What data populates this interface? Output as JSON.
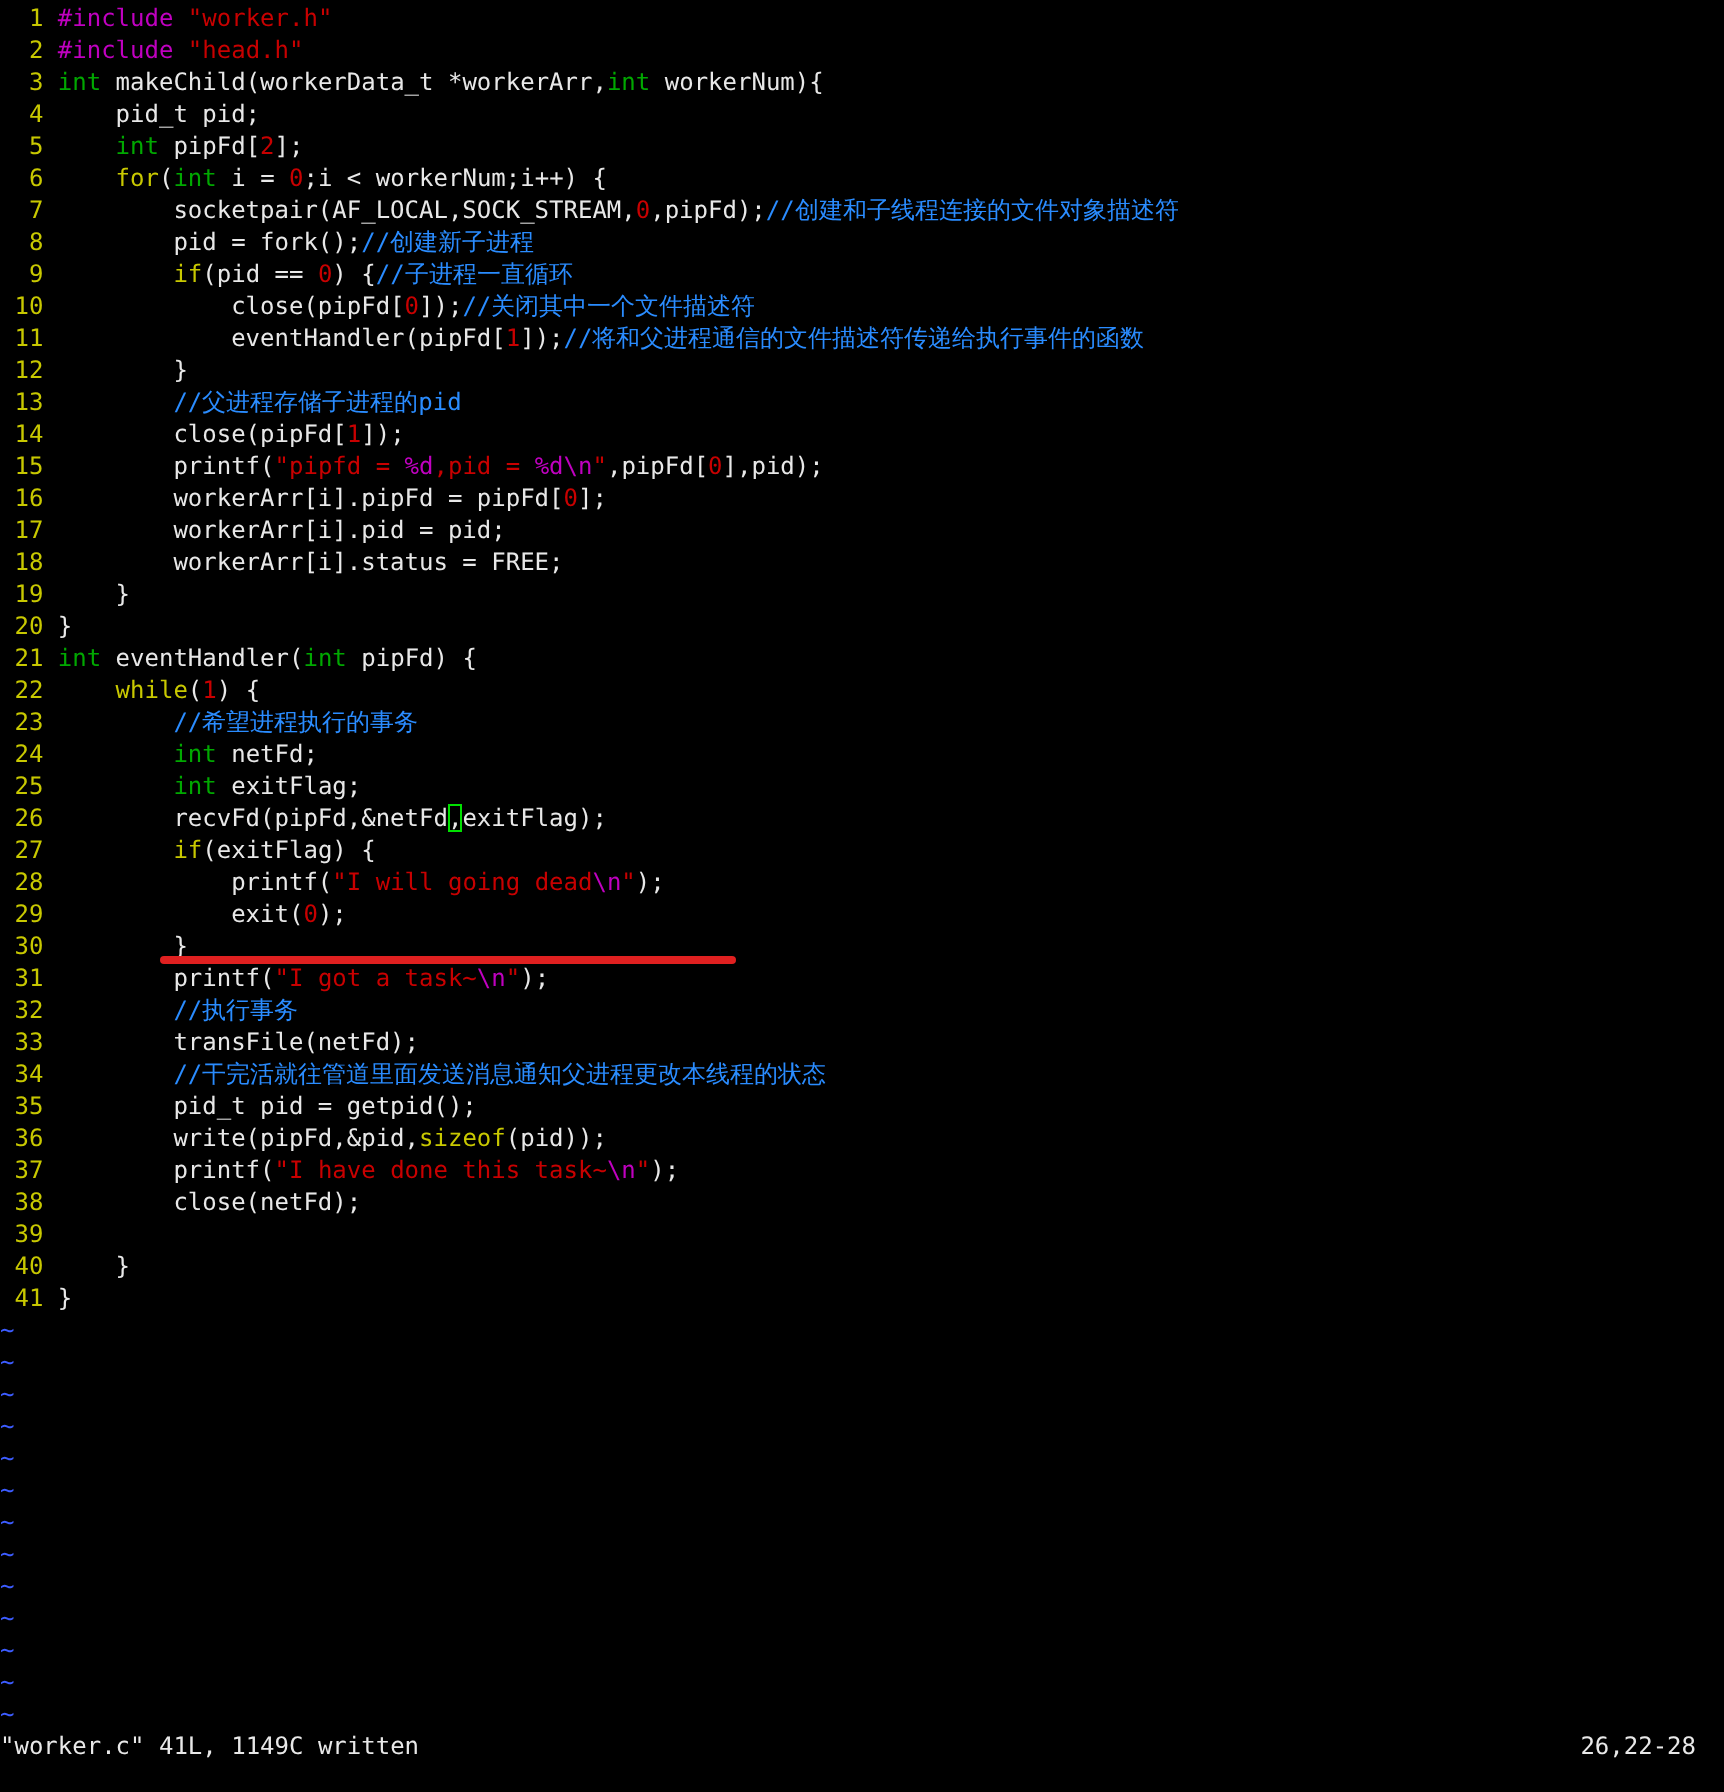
{
  "editor": {
    "lines": [
      {
        "number": "1",
        "tokens": [
          {
            "kind": "preproc",
            "text": "#include "
          },
          {
            "kind": "string",
            "text": "\"worker.h\""
          }
        ]
      },
      {
        "number": "2",
        "tokens": [
          {
            "kind": "preproc",
            "text": "#include "
          },
          {
            "kind": "string",
            "text": "\"head.h\""
          }
        ]
      },
      {
        "number": "3",
        "tokens": [
          {
            "kind": "type",
            "text": "int"
          },
          {
            "kind": "plain",
            "text": " makeChild(workerData_t *workerArr,"
          },
          {
            "kind": "type",
            "text": "int"
          },
          {
            "kind": "plain",
            "text": " workerNum){"
          }
        ]
      },
      {
        "number": "4",
        "tokens": [
          {
            "kind": "plain",
            "text": "    pid_t pid;"
          }
        ]
      },
      {
        "number": "5",
        "tokens": [
          {
            "kind": "type",
            "text": "    int"
          },
          {
            "kind": "plain",
            "text": " pipFd["
          },
          {
            "kind": "number",
            "text": "2"
          },
          {
            "kind": "plain",
            "text": "];"
          }
        ]
      },
      {
        "number": "6",
        "tokens": [
          {
            "kind": "statement",
            "text": "    for"
          },
          {
            "kind": "plain",
            "text": "("
          },
          {
            "kind": "type",
            "text": "int"
          },
          {
            "kind": "plain",
            "text": " i = "
          },
          {
            "kind": "number",
            "text": "0"
          },
          {
            "kind": "plain",
            "text": ";i < workerNum;i++) {"
          }
        ]
      },
      {
        "number": "7",
        "tokens": [
          {
            "kind": "plain",
            "text": "        socketpair(AF_LOCAL,SOCK_STREAM,"
          },
          {
            "kind": "number",
            "text": "0"
          },
          {
            "kind": "plain",
            "text": ",pipFd);"
          },
          {
            "kind": "comment",
            "text": "//创建和子线程连接的文件对象描述符"
          }
        ]
      },
      {
        "number": "8",
        "tokens": [
          {
            "kind": "plain",
            "text": "        pid = fork();"
          },
          {
            "kind": "comment",
            "text": "//创建新子进程"
          }
        ]
      },
      {
        "number": "9",
        "tokens": [
          {
            "kind": "statement",
            "text": "        if"
          },
          {
            "kind": "plain",
            "text": "(pid == "
          },
          {
            "kind": "number",
            "text": "0"
          },
          {
            "kind": "plain",
            "text": ") {"
          },
          {
            "kind": "comment",
            "text": "//子进程一直循环"
          }
        ]
      },
      {
        "number": "10",
        "tokens": [
          {
            "kind": "plain",
            "text": "            close(pipFd["
          },
          {
            "kind": "number",
            "text": "0"
          },
          {
            "kind": "plain",
            "text": "]);"
          },
          {
            "kind": "comment",
            "text": "//关闭其中一个文件描述符"
          }
        ]
      },
      {
        "number": "11",
        "tokens": [
          {
            "kind": "plain",
            "text": "            eventHandler(pipFd["
          },
          {
            "kind": "number",
            "text": "1"
          },
          {
            "kind": "plain",
            "text": "]);"
          },
          {
            "kind": "comment",
            "text": "//将和父进程通信的文件描述符传递给执行事件的函数"
          }
        ]
      },
      {
        "number": "12",
        "tokens": [
          {
            "kind": "plain",
            "text": "        }"
          }
        ]
      },
      {
        "number": "13",
        "tokens": [
          {
            "kind": "comment",
            "text": "        //父进程存储子进程的pid"
          }
        ]
      },
      {
        "number": "14",
        "tokens": [
          {
            "kind": "plain",
            "text": "        close(pipFd["
          },
          {
            "kind": "number",
            "text": "1"
          },
          {
            "kind": "plain",
            "text": "]);"
          }
        ]
      },
      {
        "number": "15",
        "tokens": [
          {
            "kind": "plain",
            "text": "        printf("
          },
          {
            "kind": "string",
            "text": "\"pipfd = "
          },
          {
            "kind": "special",
            "text": "%d"
          },
          {
            "kind": "string",
            "text": ",pid = "
          },
          {
            "kind": "special",
            "text": "%d\\n"
          },
          {
            "kind": "string",
            "text": "\""
          },
          {
            "kind": "plain",
            "text": ",pipFd["
          },
          {
            "kind": "number",
            "text": "0"
          },
          {
            "kind": "plain",
            "text": "],pid);"
          }
        ]
      },
      {
        "number": "16",
        "tokens": [
          {
            "kind": "plain",
            "text": "        workerArr[i].pipFd = pipFd["
          },
          {
            "kind": "number",
            "text": "0"
          },
          {
            "kind": "plain",
            "text": "];"
          }
        ]
      },
      {
        "number": "17",
        "tokens": [
          {
            "kind": "plain",
            "text": "        workerArr[i].pid = pid;"
          }
        ]
      },
      {
        "number": "18",
        "tokens": [
          {
            "kind": "plain",
            "text": "        workerArr[i].status = FREE;"
          }
        ]
      },
      {
        "number": "19",
        "tokens": [
          {
            "kind": "plain",
            "text": "    }"
          }
        ]
      },
      {
        "number": "20",
        "tokens": [
          {
            "kind": "plain",
            "text": "}"
          }
        ]
      },
      {
        "number": "21",
        "tokens": [
          {
            "kind": "type",
            "text": "int"
          },
          {
            "kind": "plain",
            "text": " eventHandler("
          },
          {
            "kind": "type",
            "text": "int"
          },
          {
            "kind": "plain",
            "text": " pipFd) {"
          }
        ]
      },
      {
        "number": "22",
        "tokens": [
          {
            "kind": "statement",
            "text": "    while"
          },
          {
            "kind": "plain",
            "text": "("
          },
          {
            "kind": "number",
            "text": "1"
          },
          {
            "kind": "plain",
            "text": ") {"
          }
        ]
      },
      {
        "number": "23",
        "tokens": [
          {
            "kind": "comment",
            "text": "        //希望进程执行的事务"
          }
        ]
      },
      {
        "number": "24",
        "tokens": [
          {
            "kind": "type",
            "text": "        int"
          },
          {
            "kind": "plain",
            "text": " netFd;"
          }
        ]
      },
      {
        "number": "25",
        "tokens": [
          {
            "kind": "type",
            "text": "        int"
          },
          {
            "kind": "plain",
            "text": " exitFlag;"
          }
        ]
      },
      {
        "number": "26",
        "tokens": [
          {
            "kind": "plain",
            "text": "        recvFd(pipFd,&netFd"
          },
          {
            "kind": "plain",
            "text": ",",
            "cursor": true
          },
          {
            "kind": "plain",
            "text": "exitFlag);"
          }
        ]
      },
      {
        "number": "27",
        "tokens": [
          {
            "kind": "statement",
            "text": "        if"
          },
          {
            "kind": "plain",
            "text": "(exitFlag) {"
          }
        ]
      },
      {
        "number": "28",
        "tokens": [
          {
            "kind": "plain",
            "text": "            printf("
          },
          {
            "kind": "string",
            "text": "\"I will going dead"
          },
          {
            "kind": "special",
            "text": "\\n"
          },
          {
            "kind": "string",
            "text": "\""
          },
          {
            "kind": "plain",
            "text": ");"
          }
        ]
      },
      {
        "number": "29",
        "tokens": [
          {
            "kind": "plain",
            "text": "            exit("
          },
          {
            "kind": "number",
            "text": "0"
          },
          {
            "kind": "plain",
            "text": ");"
          }
        ]
      },
      {
        "number": "30",
        "tokens": [
          {
            "kind": "plain",
            "text": "        }"
          }
        ]
      },
      {
        "number": "31",
        "annotation_mark": true,
        "tokens": [
          {
            "kind": "plain",
            "text": "        printf("
          },
          {
            "kind": "string",
            "text": "\"I got a task~"
          },
          {
            "kind": "special",
            "text": "\\n"
          },
          {
            "kind": "string",
            "text": "\""
          },
          {
            "kind": "plain",
            "text": ");"
          }
        ]
      },
      {
        "number": "32",
        "tokens": [
          {
            "kind": "comment",
            "text": "        //执行事务"
          }
        ]
      },
      {
        "number": "33",
        "tokens": [
          {
            "kind": "plain",
            "text": "        transFile(netFd);"
          }
        ]
      },
      {
        "number": "34",
        "tokens": [
          {
            "kind": "comment",
            "text": "        //干完活就往管道里面发送消息通知父进程更改本线程的状态"
          }
        ]
      },
      {
        "number": "35",
        "tokens": [
          {
            "kind": "plain",
            "text": "        pid_t pid = getpid();"
          }
        ]
      },
      {
        "number": "36",
        "tokens": [
          {
            "kind": "plain",
            "text": "        write(pipFd,&pid,"
          },
          {
            "kind": "statement",
            "text": "sizeof"
          },
          {
            "kind": "plain",
            "text": "(pid));"
          }
        ]
      },
      {
        "number": "37",
        "tokens": [
          {
            "kind": "plain",
            "text": "        printf("
          },
          {
            "kind": "string",
            "text": "\"I have done this task~"
          },
          {
            "kind": "special",
            "text": "\\n"
          },
          {
            "kind": "string",
            "text": "\""
          },
          {
            "kind": "plain",
            "text": ");"
          }
        ]
      },
      {
        "number": "38",
        "tokens": [
          {
            "kind": "plain",
            "text": "        close(netFd);"
          }
        ]
      },
      {
        "number": "39"
      },
      {
        "number": "40",
        "tokens": [
          {
            "kind": "plain",
            "text": "    }"
          }
        ]
      },
      {
        "number": "41",
        "tokens": [
          {
            "kind": "plain",
            "text": "}"
          }
        ]
      }
    ],
    "filler_lines": [
      "~",
      "~",
      "~",
      "~",
      "~",
      "~",
      "~",
      "~",
      "~",
      "~",
      "~",
      "~",
      "~"
    ]
  },
  "status_bar": {
    "message": "\"worker.c\" 41L, 1149C written",
    "ruler": "26,22-28"
  }
}
